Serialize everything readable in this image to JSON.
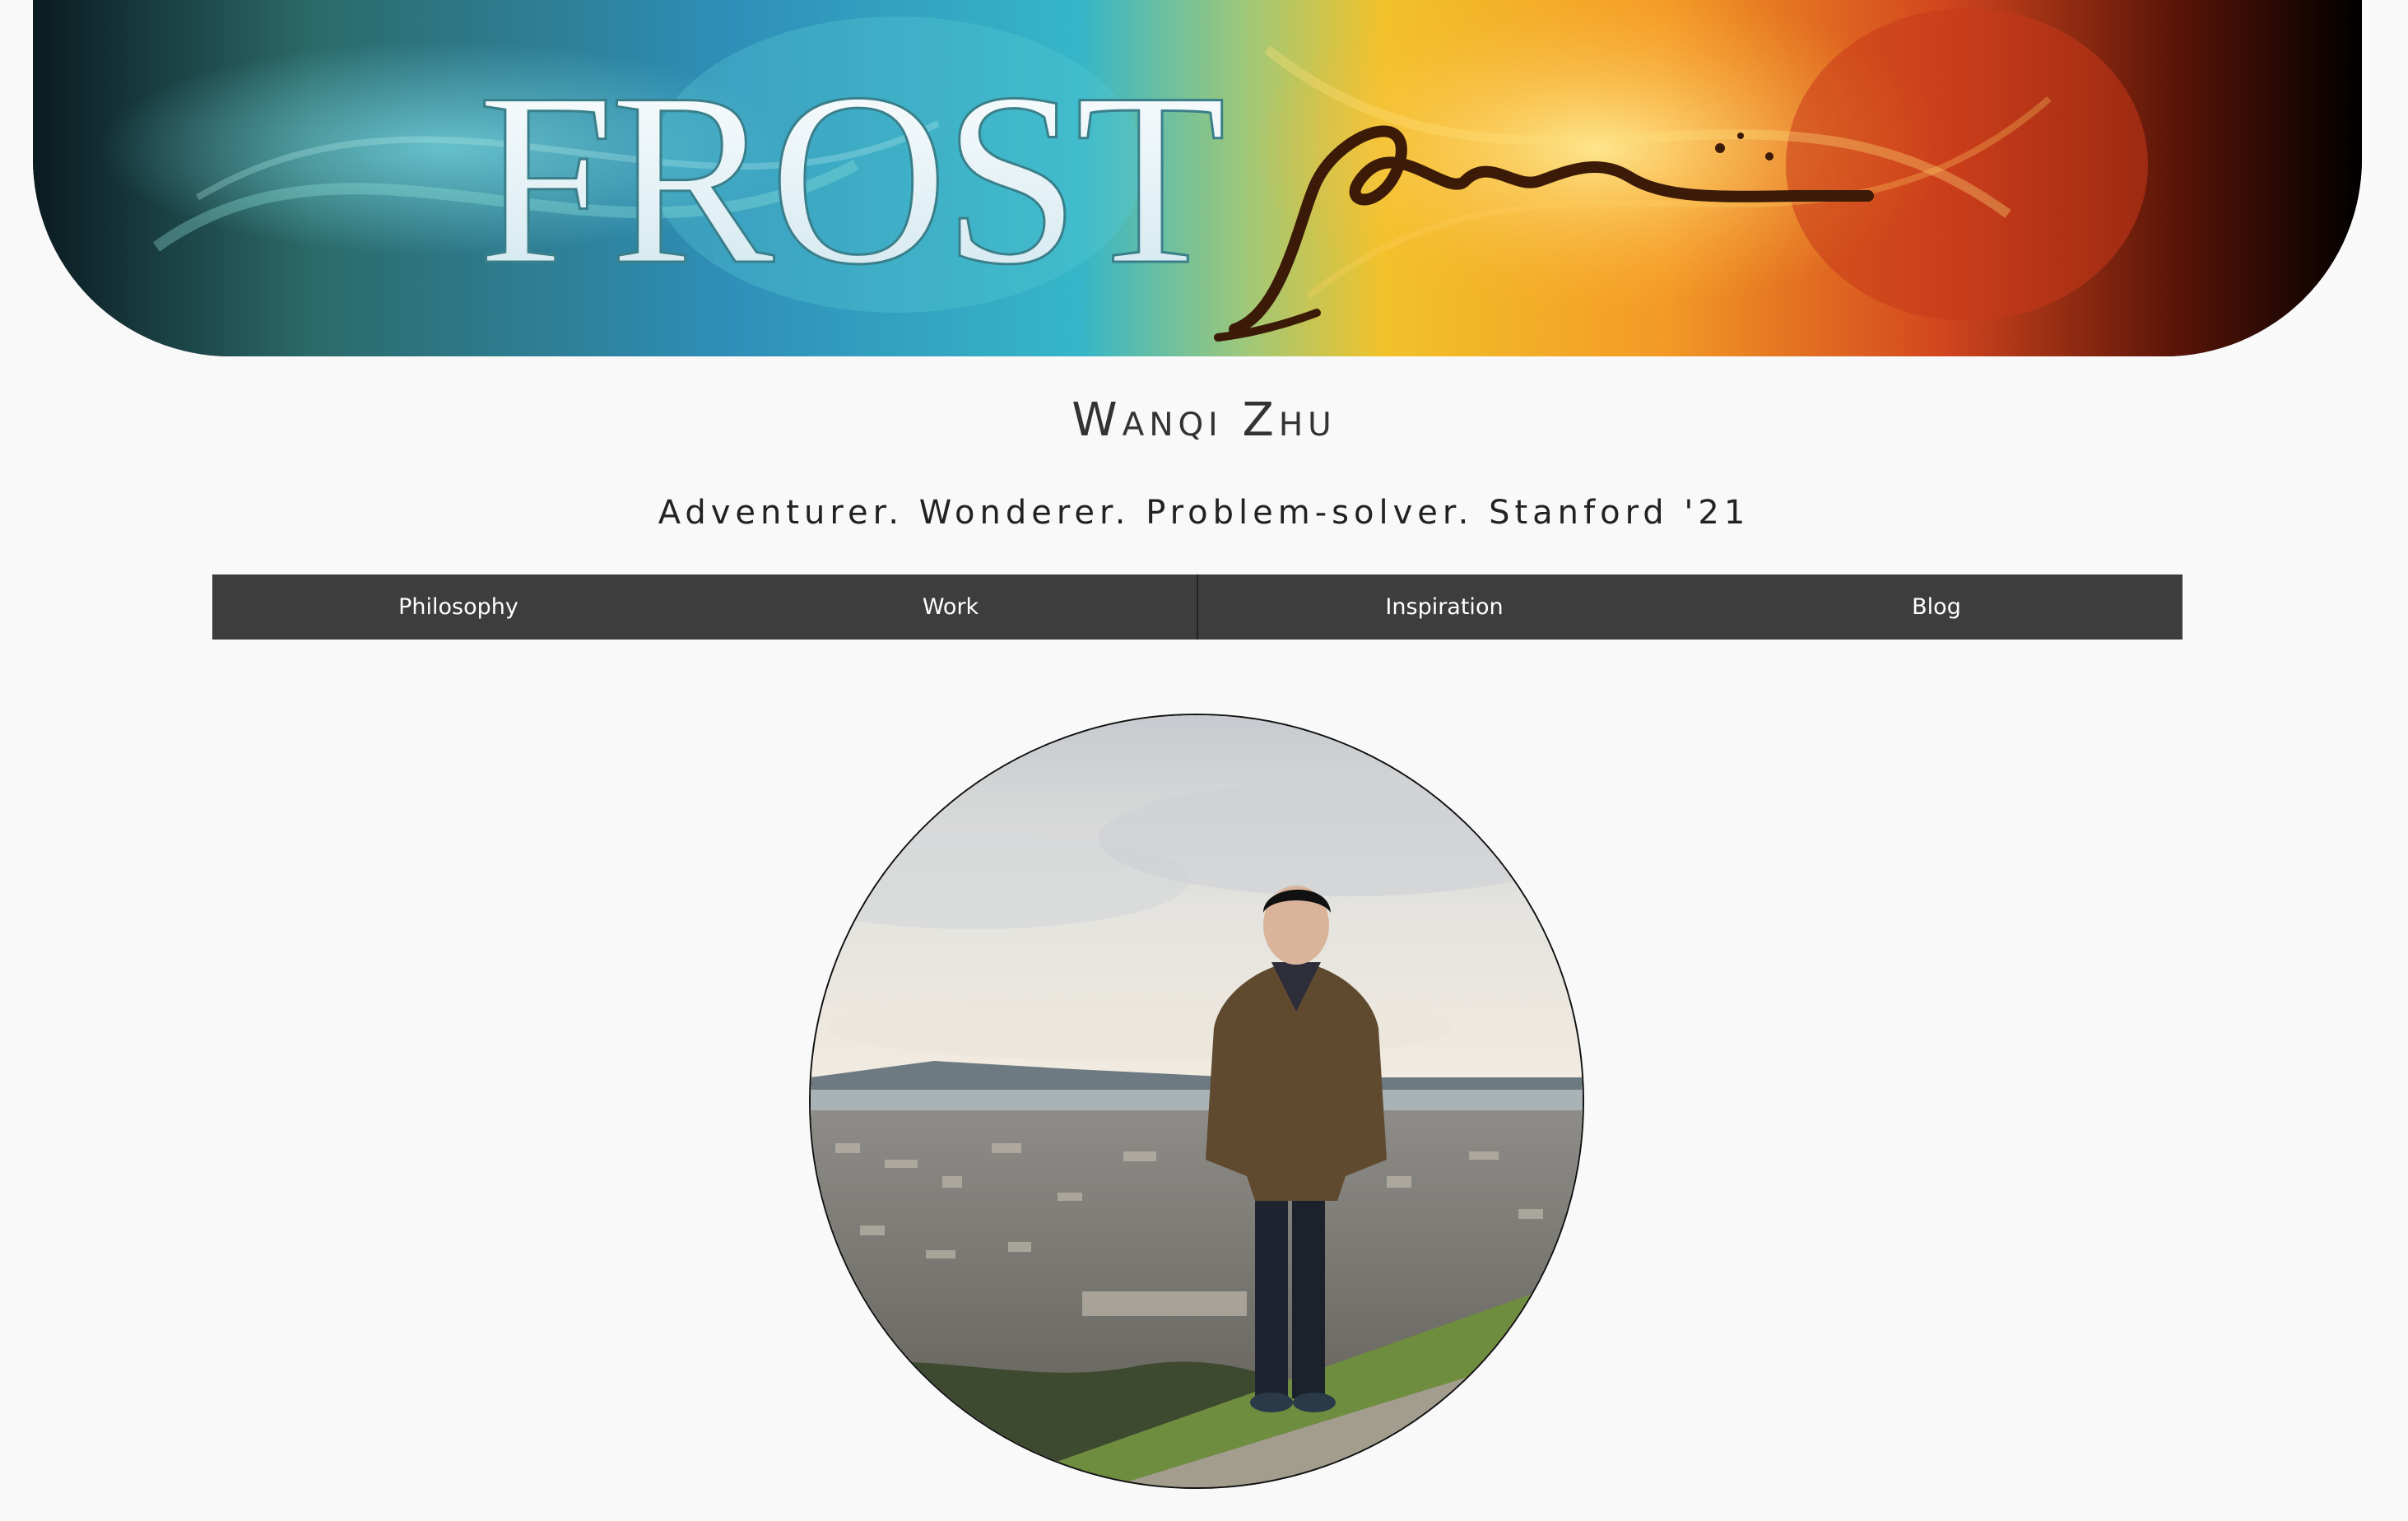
{
  "banner": {
    "logo_text": "FROST",
    "logo_script": "fire"
  },
  "header": {
    "name": "Wanqi Zhu",
    "tagline": "Adventurer. Wonderer. Problem-solver. Stanford '21"
  },
  "nav": {
    "items": [
      {
        "label": "Philosophy"
      },
      {
        "label": "Work"
      },
      {
        "label": "Inspiration"
      },
      {
        "label": "Blog"
      }
    ]
  }
}
